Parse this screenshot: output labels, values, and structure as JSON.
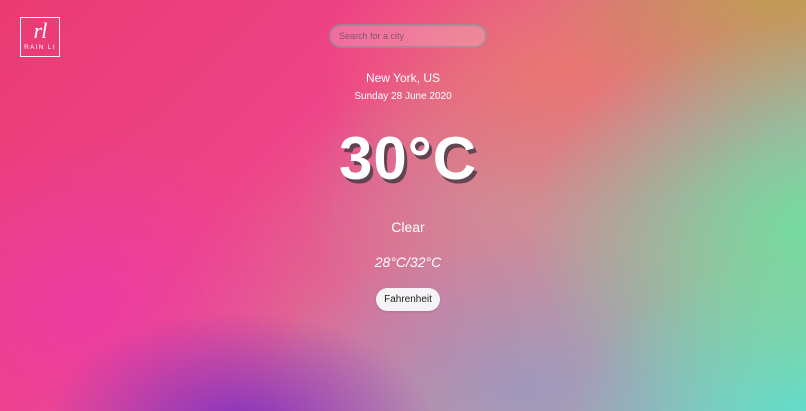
{
  "logo": {
    "mark": "rl",
    "text": "RAIN LI"
  },
  "search": {
    "placeholder": "Search for a city",
    "value": ""
  },
  "weather": {
    "location": "New York, US",
    "date": "Sunday 28 June 2020",
    "temperature": "30°C",
    "condition": "Clear",
    "range": "28°C/32°C"
  },
  "unit_toggle": {
    "label": "Fahrenheit"
  }
}
